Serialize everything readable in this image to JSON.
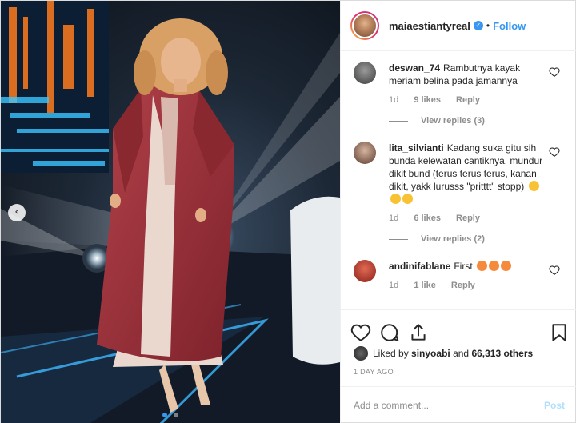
{
  "post": {
    "username": "maiaestiantyreal",
    "separator": "•",
    "follow_label": "Follow",
    "photo_prev_glyph": "‹",
    "icons": {
      "verified": "verified-badge-icon",
      "like": "heart-icon",
      "comment": "comment-bubble-icon",
      "share": "share-icon",
      "save": "bookmark-icon",
      "nav": "chevron-left-icon"
    },
    "likes": {
      "prefix": "Liked by",
      "user": "sinyoabi",
      "middle": "and",
      "count": "66,313 others"
    },
    "date": "1 DAY AGO",
    "add_comment_placeholder": "Add a comment...",
    "post_label": "Post",
    "carousel": {
      "current": 1,
      "total": 2
    }
  },
  "comments": [
    {
      "user": "deswan_74",
      "text": "Rambutnya kayak meriam belina pada jamannya",
      "age": "1d",
      "likes": "9 likes",
      "reply": "Reply",
      "view_replies": "View replies (3)"
    },
    {
      "user": "lita_silvianti",
      "text": "Kadang suka gitu sih bunda kelewatan cantiknya, mundur dikit bund (terus terus terus, kanan dikit, yakk lurusss \"pritttt\" stopp)",
      "emoji": [
        "laughing-emoji",
        "laughing-emoji",
        "laughing-emoji"
      ],
      "age": "1d",
      "likes": "6 likes",
      "reply": "Reply",
      "view_replies": "View replies (2)"
    },
    {
      "user": "andinifablane",
      "text": "First",
      "emoji": [
        "winking-kiss-emoji",
        "winking-kiss-emoji",
        "heart-eyes-emoji"
      ],
      "age": "1d",
      "likes": "1 like",
      "reply": "Reply"
    }
  ],
  "colors": {
    "accent": "#3897f0",
    "text": "#262626",
    "muted": "#8e8e8e",
    "border": "#efefef",
    "coat": "#9c2f36"
  }
}
